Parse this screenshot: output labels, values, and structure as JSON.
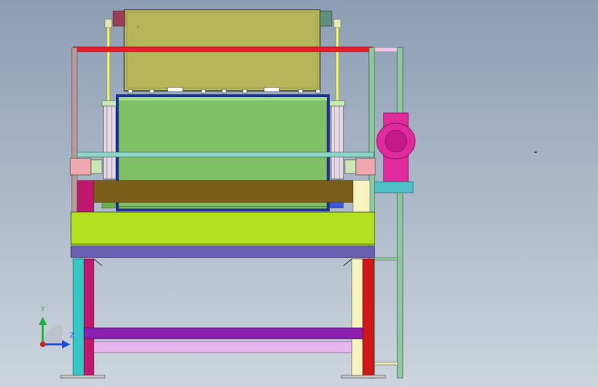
{
  "viewport": {
    "background_top": "#8d9db3",
    "background_bottom": "#cdd4dd"
  },
  "triad": {
    "y_label": "Y",
    "z_label": "Z",
    "y_color": "#1bb23a",
    "z_color": "#1f4fd6",
    "origin_color": "#d02020"
  },
  "model": {
    "top_hood_color": "#b5b65a",
    "drum_color": "#7fc066",
    "drum_border_color": "#1b2fa0",
    "red_bar_color": "#e0202a",
    "table_color": "#b3e11f",
    "blue_beam_color": "#6a5fb0",
    "purple_bar_color": "#8c1fae",
    "pink_bar_color": "#e8b6ee",
    "magenta_motor_color": "#e02a9e",
    "olive_band_color": "#7a5e18"
  },
  "status_marker": "·"
}
